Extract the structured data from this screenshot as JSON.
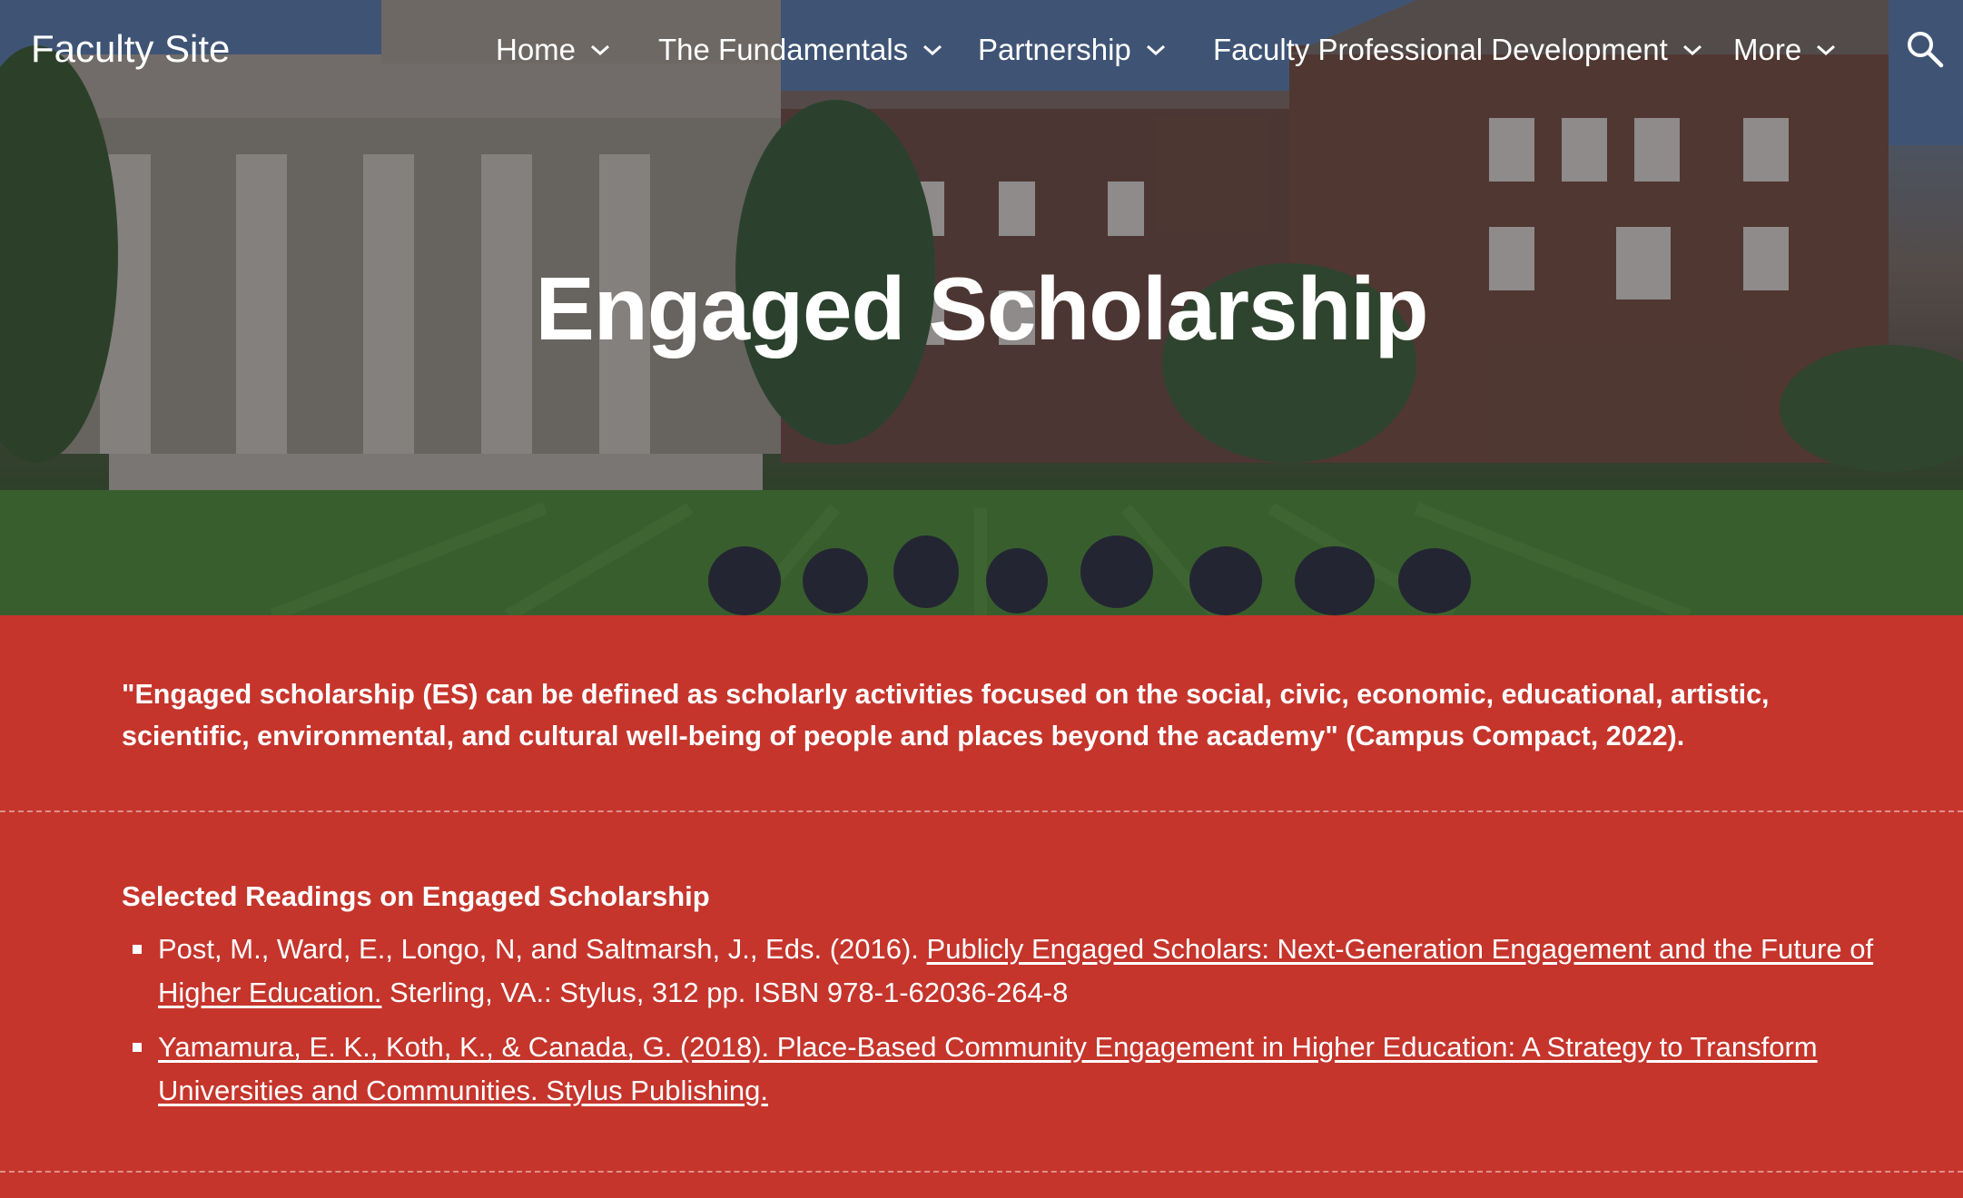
{
  "nav": {
    "site_title": "Faculty Site",
    "items": [
      {
        "label": "Home",
        "icon": "chevron-down-icon"
      },
      {
        "label": "The Fundamentals",
        "icon": "chevron-down-icon"
      },
      {
        "label": "Partnership",
        "icon": "chevron-down-icon"
      },
      {
        "label": "Faculty Professional Development",
        "icon": "chevron-down-icon"
      },
      {
        "label": "More",
        "icon": "chevron-down-icon"
      }
    ],
    "search_icon": "search-icon"
  },
  "hero": {
    "title": "Engaged Scholarship",
    "image": "campus-lawn-photo"
  },
  "intro": {
    "quote": "\"Engaged scholarship (ES) can be defined as scholarly activities focused on the social, civic, economic, educational, artistic, scientific, environmental, and cultural well-being of people and places beyond the academy\" (Campus Compact, 2022)."
  },
  "readings": {
    "heading": "Selected Readings on Engaged Scholarship",
    "items": [
      {
        "prefix": "Post, M., Ward, E., Longo, N, and Saltmarsh, J., Eds. (2016). ",
        "link": "Publicly Engaged Scholars: Next-Generation Engagement and the Future of Higher Education.",
        "suffix": " Sterling, VA.: Stylus, 312 pp. ISBN 978-1-62036-264-8"
      },
      {
        "prefix": "",
        "link": "Yamamura, E. K., Koth, K., & Canada, G. (2018). Place-Based Community Engagement in Higher Education: A Strategy to Transform Universities and Communities. Stylus Publishing.",
        "suffix": ""
      }
    ]
  },
  "colors": {
    "content_background": "#c5352c",
    "text": "#ffffff"
  }
}
